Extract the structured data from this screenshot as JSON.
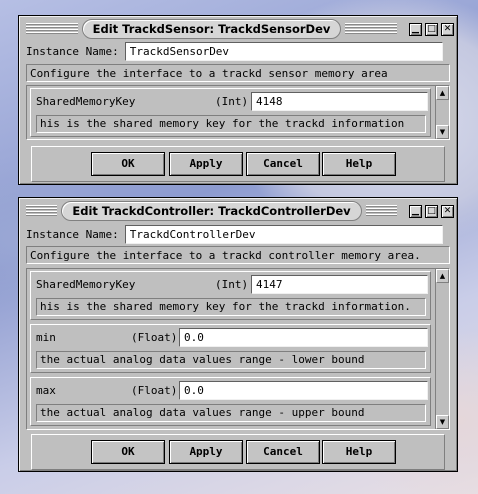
{
  "window1": {
    "title": "Edit TrackdSensor: TrackdSensorDev",
    "instance_label": "Instance Name:",
    "instance_value": "TrackdSensorDev",
    "description": "Configure the interface to a trackd sensor memory area",
    "params": [
      {
        "name": "SharedMemoryKey",
        "type": "(Int)",
        "value": "4148",
        "help": "his is the shared memory key for the trackd information"
      }
    ],
    "buttons": [
      "OK",
      "Apply",
      "Cancel",
      "Help"
    ]
  },
  "window2": {
    "title": "Edit TrackdController: TrackdControllerDev",
    "instance_label": "Instance Name:",
    "instance_value": "TrackdControllerDev",
    "description": "Configure the interface to a trackd controller memory area.",
    "params": [
      {
        "name": "SharedMemoryKey",
        "type": "(Int)",
        "value": "4147",
        "help": "his is the shared memory key for the trackd information."
      },
      {
        "name": "min",
        "type": "(Float)",
        "value": "0.0",
        "help": "the actual analog data values range - lower bound"
      },
      {
        "name": "max",
        "type": "(Float)",
        "value": "0.0",
        "help": "the actual analog data values range - upper bound"
      }
    ],
    "buttons": [
      "OK",
      "Apply",
      "Cancel",
      "Help"
    ]
  },
  "titlebar_buttons": {
    "minimize": "▁",
    "maximize": "□",
    "close": "✕"
  },
  "icons": {
    "scroll_up": "up-arrow-icon",
    "scroll_down": "down-arrow-icon"
  }
}
